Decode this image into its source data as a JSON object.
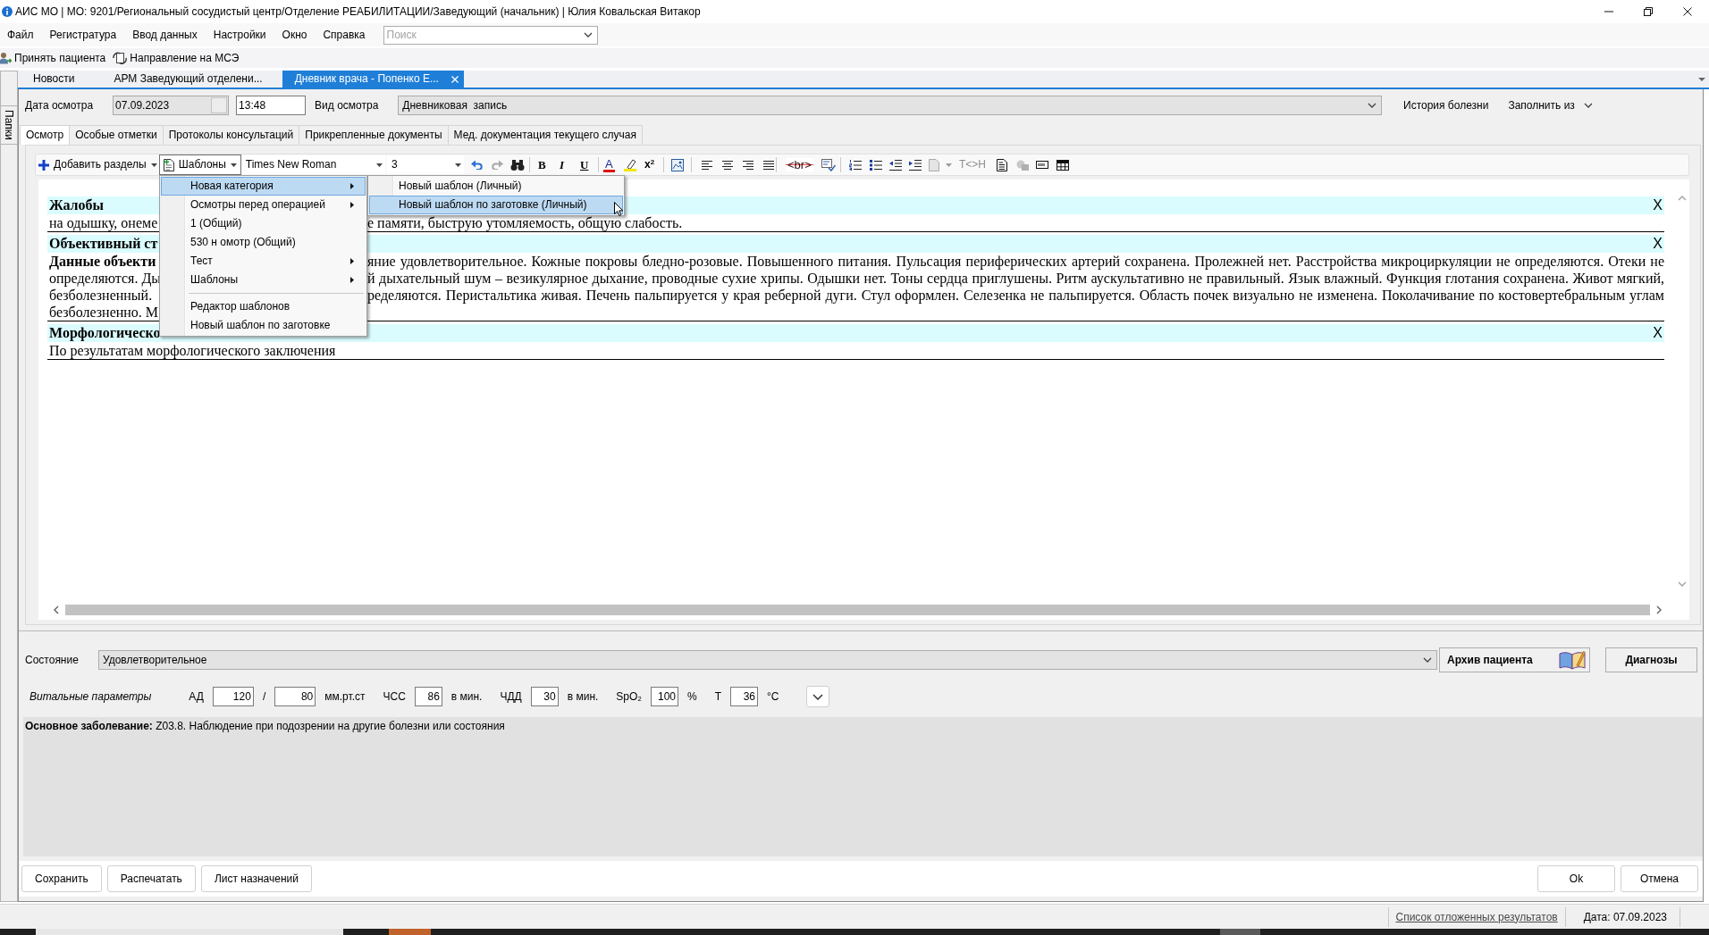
{
  "window": {
    "title": "АИС МО | МО: 9201/Региональный сосудистый центр/Отделение РЕАБИЛИТАЦИИ/Заведующий (начальник) | Юлия Ковальская Витакор"
  },
  "menu_bar": {
    "items": [
      "Файл",
      "Регистратура",
      "Ввод данных",
      "Настройки",
      "Окно",
      "Справка"
    ],
    "search": {
      "placeholder": "Поиск"
    }
  },
  "toolbar": {
    "items": [
      "Принять пациента",
      "Направление на МСЭ"
    ]
  },
  "side_panel": {
    "label": "Папки"
  },
  "document_tabs": [
    {
      "label": "Новости",
      "selected": false
    },
    {
      "label": "АРМ Заведующий отделени...",
      "selected": false
    },
    {
      "label": "Дневник врача - Попенко Е...",
      "selected": true
    }
  ],
  "exam_header": {
    "date_label": "Дата осмотра",
    "date": "07.09.2023",
    "time": "13:48",
    "type_label": "Вид осмотра",
    "type": "Дневниковая  запись",
    "history_button": "История болезни",
    "fill_from_button": "Заполнить из"
  },
  "tabs": [
    {
      "label": "Осмотр",
      "selected": true
    },
    {
      "label": "Особые отметки",
      "selected": false
    },
    {
      "label": "Протоколы консультаций",
      "selected": false
    },
    {
      "label": "Прикрепленные документы",
      "selected": false
    },
    {
      "label": "Мед. документация текущего случая",
      "selected": false
    }
  ],
  "editor_toolbar": {
    "add_sections": "Добавить разделы",
    "templates": "Шаблоны",
    "font": "Times New Roman",
    "size": "3",
    "bold": "B",
    "italic": "I",
    "underline": "U",
    "font_color": "A",
    "superscript": "x$^{2}$",
    "line_break": "<br>",
    "tag_toggle": {
      "label": "T<>H",
      "disabled": true
    }
  },
  "templates_menu": {
    "items": [
      {
        "kind": "item",
        "label": "Новая категория",
        "submenu": true,
        "selected": true
      },
      {
        "kind": "item",
        "label": "Осмотры перед операцией",
        "submenu": true,
        "selected": false
      },
      {
        "kind": "item",
        "label": "1 (Общий)",
        "submenu": false,
        "selected": false
      },
      {
        "kind": "item",
        "label": "530 н омотр (Общий)",
        "submenu": false,
        "selected": false
      },
      {
        "kind": "item",
        "label": "Тест",
        "submenu": true,
        "selected": false
      },
      {
        "kind": "item",
        "label": "Шаблоны",
        "submenu": true,
        "selected": false
      },
      {
        "kind": "separator"
      },
      {
        "kind": "item",
        "label": "Редактор шаблонов",
        "submenu": false,
        "selected": false
      },
      {
        "kind": "item",
        "label": "Новый шаблон по заготовке",
        "submenu": false,
        "selected": false
      }
    ]
  },
  "templates_submenu": {
    "items": [
      {
        "label": "Новый шаблон (Личный)",
        "selected": false
      },
      {
        "label": "Новый шаблон по заготовке (Личный)",
        "selected": true
      }
    ]
  },
  "document": {
    "sections": [
      {
        "title": "Жалобы",
        "close": "X",
        "lines": [
          {
            "start": "на одышку, онеме",
            "end": "е памяти, быструю утомляемость, общую слабость."
          }
        ]
      },
      {
        "title": "Объективный ст",
        "close": "X",
        "lines": [
          {
            "start": "**Данные объекти**",
            "end": "яние удовлетворительное. Кожные покровы бледно-розовые. Повышенного питания. Пульсация периферических артерий сохранена. Пролежней нет. Расстройства микроциркуляции не определяются. Отеки не"
          },
          {
            "start": "определяются. Ды",
            "end": "й дыхательный шум – везикулярное дыхание, проводные сухие хрипы. Одышки нет. Тоны сердца приглушены. Ритм аускультативно не правильный. Язык влажный. Функция глотания сохранена. Живот мягкий,"
          },
          {
            "start": "безболезненный.",
            "end": "ределяются. Перистальтика живая. Печень пальпируется у края реберной дуги. Стул оформлен. Селезенка не пальпируется. Область почек визуально не изменена. Поколачивание по костовертебральным углам"
          },
          {
            "start": "безболезненно. М"
          }
        ]
      },
      {
        "title": "Морфологическо",
        "close": "X",
        "lines": [
          {
            "start": "По результатам морфологического заключения"
          }
        ]
      }
    ]
  },
  "condition": {
    "label": "Состояние",
    "value": "Удовлетворительное"
  },
  "side_buttons": {
    "archive": "Архив пациента",
    "diagnoses": "Диагнозы"
  },
  "vitals": {
    "label": "Витальные параметры",
    "items": [
      {
        "kind": "label",
        "text": "АД"
      },
      {
        "kind": "widefield",
        "text": "120"
      },
      {
        "kind": "unit",
        "text": "/"
      },
      {
        "kind": "widefield",
        "text": "80"
      },
      {
        "kind": "unit",
        "text": "мм.рт.ст"
      },
      {
        "kind": "label",
        "text": "ЧСС"
      },
      {
        "kind": "field",
        "text": "86"
      },
      {
        "kind": "unit",
        "text": "в мин."
      },
      {
        "kind": "label",
        "text": "ЧДД"
      },
      {
        "kind": "field",
        "text": "30"
      },
      {
        "kind": "unit",
        "text": "в мин."
      },
      {
        "kind": "label",
        "text": "SpO₂"
      },
      {
        "kind": "field",
        "text": "100"
      },
      {
        "kind": "unit",
        "text": "%"
      },
      {
        "kind": "label",
        "text": "Т"
      },
      {
        "kind": "field",
        "text": "36"
      },
      {
        "kind": "unit",
        "text": "°С"
      }
    ]
  },
  "diagnosis": "**Основное заболевание:** Z03.8. Наблюдение при подозрении на другие болезни или состояния",
  "actions": {
    "left": [
      "Сохранить",
      "Распечатать",
      "Лист назначений"
    ],
    "right": [
      "Ok",
      "Отмена"
    ]
  },
  "status_bar": {
    "link": "Список отложенных результатов",
    "date": "Дата: 07.09.2023"
  }
}
